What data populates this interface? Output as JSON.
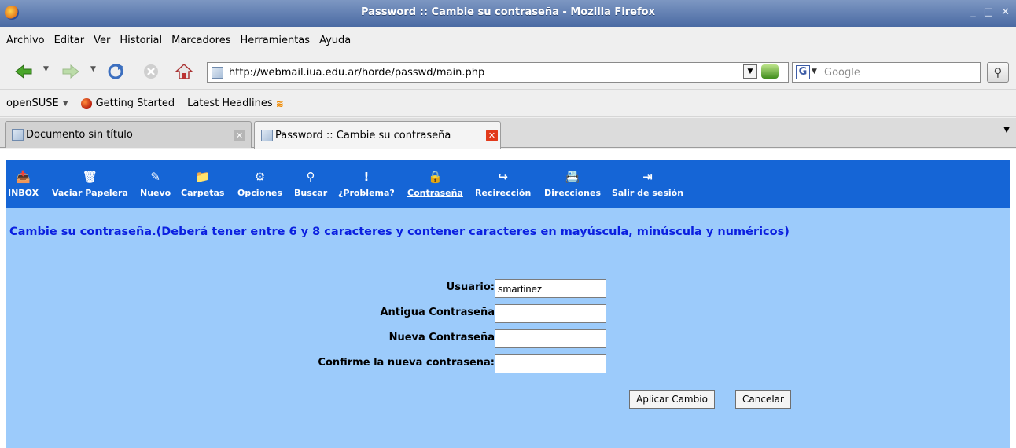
{
  "window": {
    "title": "Password :: Cambie su contraseña - Mozilla Firefox",
    "controls": [
      "_",
      "□",
      "✕"
    ]
  },
  "menubar": {
    "items": [
      "Archivo",
      "Editar",
      "Ver",
      "Historial",
      "Marcadores",
      "Herramientas",
      "Ayuda"
    ]
  },
  "navbar": {
    "url": "http://webmail.iua.edu.ar/horde/passwd/main.php",
    "search_placeholder": "Google",
    "search_engine_letter": "G"
  },
  "bookmarks": {
    "items": [
      "openSUSE",
      "Getting Started",
      "Latest Headlines"
    ]
  },
  "tabs": [
    {
      "label": "Documento sin título"
    },
    {
      "label": "Password :: Cambie su contraseña"
    }
  ],
  "horde_nav": {
    "items": [
      "INBOX",
      "Vaciar Papelera",
      "Nuevo",
      "Carpetas",
      "Opciones",
      "Buscar",
      "¿Problema?",
      "Contraseña",
      "Recirección",
      "Direcciones",
      "Salir de sesión"
    ],
    "active": "Contraseña"
  },
  "form": {
    "headline": "Cambie su contraseña.(Deberá tener entre 6 y 8 caracteres y contener caracteres en mayúscula, minúscula y numéricos)",
    "username_label": "Usuario:",
    "username_value": "smartinez",
    "old_password_label": "Antigua Contraseña",
    "new_password_label": "Nueva Contraseña",
    "confirm_password_label": "Confirme la nueva contraseña:",
    "submit_label": "Aplicar Cambio",
    "cancel_label": "Cancelar"
  }
}
